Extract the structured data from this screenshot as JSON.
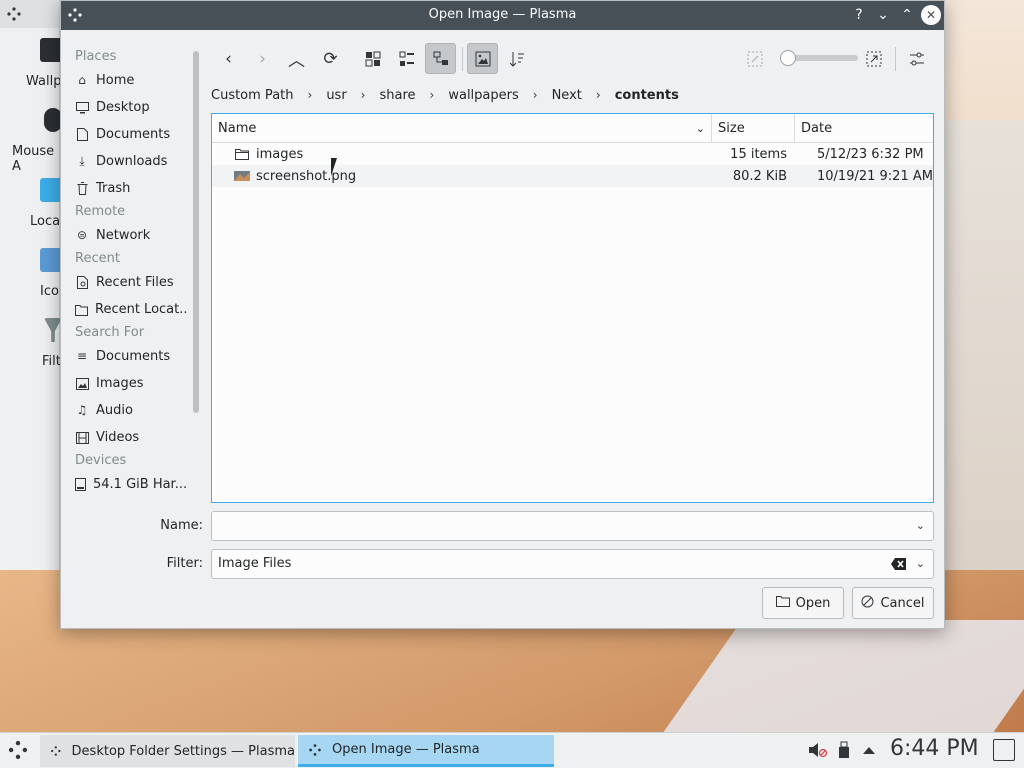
{
  "desktop_window": {
    "items": [
      {
        "label": "Wallp"
      },
      {
        "label": "Mouse A"
      },
      {
        "label": "Loca"
      },
      {
        "label": "Ico"
      },
      {
        "label": "Filt"
      }
    ]
  },
  "dialog": {
    "title": "Open Image — Plasma",
    "titlebar_buttons": {
      "help": "?",
      "minimize": "⌄",
      "maximize": "⌃",
      "close": "✕"
    }
  },
  "sidebar": {
    "sections": [
      {
        "heading": "Places",
        "items": [
          {
            "label": "Home",
            "icon": "home-icon"
          },
          {
            "label": "Desktop",
            "icon": "desktop-icon"
          },
          {
            "label": "Documents",
            "icon": "document-icon"
          },
          {
            "label": "Downloads",
            "icon": "download-icon"
          },
          {
            "label": "Trash",
            "icon": "trash-icon"
          }
        ]
      },
      {
        "heading": "Remote",
        "items": [
          {
            "label": "Network",
            "icon": "network-icon"
          }
        ]
      },
      {
        "heading": "Recent",
        "items": [
          {
            "label": "Recent Files",
            "icon": "recent-files-icon"
          },
          {
            "label": "Recent Locat...",
            "icon": "recent-locations-icon"
          }
        ]
      },
      {
        "heading": "Search For",
        "items": [
          {
            "label": "Documents",
            "icon": "search-documents-icon"
          },
          {
            "label": "Images",
            "icon": "image-icon"
          },
          {
            "label": "Audio",
            "icon": "audio-icon"
          },
          {
            "label": "Videos",
            "icon": "video-icon"
          }
        ]
      },
      {
        "heading": "Devices",
        "items": [
          {
            "label": "54.1 GiB Har...",
            "icon": "harddisk-icon"
          }
        ]
      }
    ]
  },
  "breadcrumb": {
    "items": [
      "Custom Path",
      "usr",
      "share",
      "wallpapers",
      "Next"
    ],
    "current": "contents"
  },
  "file_view": {
    "columns": {
      "name": "Name",
      "size": "Size",
      "date": "Date"
    },
    "rows": [
      {
        "name": "images",
        "size": "15 items",
        "date": "5/12/23 6:32 PM",
        "type": "folder-icon"
      },
      {
        "name": "screenshot.png",
        "size": "80.2 KiB",
        "date": "10/19/21 9:21 AM",
        "type": "image-file-icon"
      }
    ]
  },
  "form": {
    "name_label": "Name:",
    "name_value": "",
    "filter_label": "Filter:",
    "filter_value": "Image Files"
  },
  "buttons": {
    "open": "Open",
    "cancel": "Cancel"
  },
  "taskbar": {
    "tasks": [
      {
        "label": "Desktop Folder Settings — Plasma",
        "active": false
      },
      {
        "label": "Open Image — Plasma",
        "active": true
      }
    ],
    "clock": "6:44 PM"
  },
  "colors": {
    "accent": "#3daee9",
    "titlebar": "#475057",
    "window_bg": "#eff0f1"
  }
}
